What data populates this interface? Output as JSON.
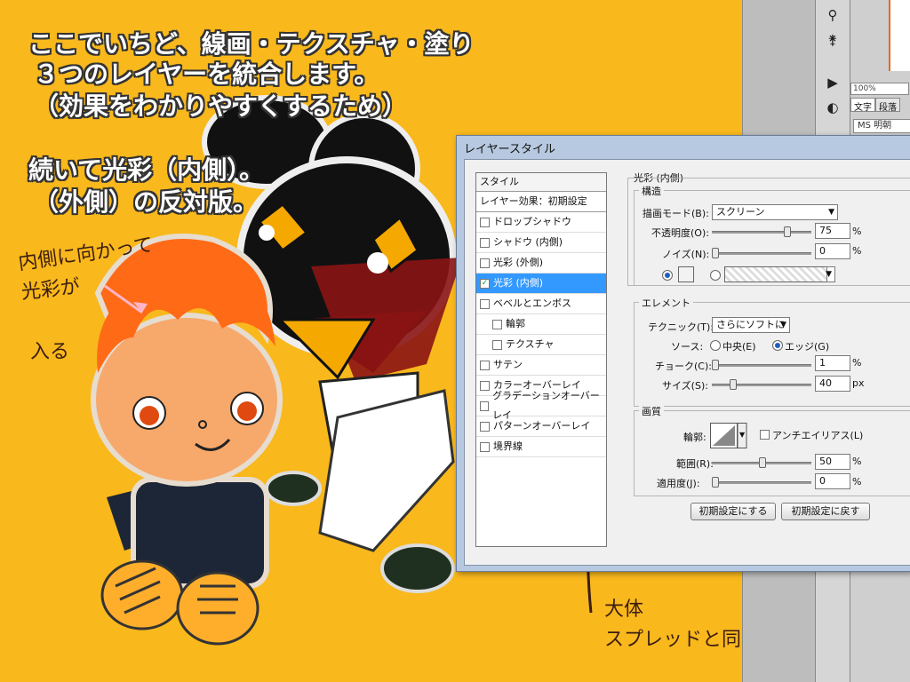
{
  "annotations": {
    "line1": "ここでいちど、線画・テクスチャ・塗り",
    "line2": "３つのレイヤーを統合します。",
    "line3": "（効果をわかりやすくするため）",
    "line4": "続いて光彩（内側）。",
    "line5": "（外側）の反対版。",
    "hand_left_1": "内側に向かって",
    "hand_left_2": "光彩が",
    "hand_left_3": "入る",
    "hand_bottom_1": "大体",
    "hand_bottom_2": "スプレッドと同じかんじ。"
  },
  "right_panel": {
    "zoom": "100%",
    "tab_text": "文字",
    "tab_paragraph": "段落",
    "font": "MS 明朝"
  },
  "dialog": {
    "title": "レイヤースタイル",
    "style_header": "スタイル",
    "blend_default": "レイヤー効果：初期設定",
    "styles": [
      {
        "label": "ドロップシャドウ",
        "checked": false,
        "selected": false,
        "sub": false
      },
      {
        "label": "シャドウ (内側)",
        "checked": false,
        "selected": false,
        "sub": false
      },
      {
        "label": "光彩 (外側)",
        "checked": false,
        "selected": false,
        "sub": false
      },
      {
        "label": "光彩 (内側)",
        "checked": true,
        "selected": true,
        "sub": false
      },
      {
        "label": "ベベルとエンボス",
        "checked": false,
        "selected": false,
        "sub": false
      },
      {
        "label": "輪郭",
        "checked": false,
        "selected": false,
        "sub": true
      },
      {
        "label": "テクスチャ",
        "checked": false,
        "selected": false,
        "sub": true
      },
      {
        "label": "サテン",
        "checked": false,
        "selected": false,
        "sub": false
      },
      {
        "label": "カラーオーバーレイ",
        "checked": false,
        "selected": false,
        "sub": false
      },
      {
        "label": "グラデーションオーバーレイ",
        "checked": false,
        "selected": false,
        "sub": false
      },
      {
        "label": "パターンオーバーレイ",
        "checked": false,
        "selected": false,
        "sub": false
      },
      {
        "label": "境界線",
        "checked": false,
        "selected": false,
        "sub": false
      }
    ],
    "panel_title": "光彩 (内側)",
    "structure": {
      "title": "構造",
      "blend_mode_label": "描画モード(B):",
      "blend_mode_value": "スクリーン",
      "opacity_label": "不透明度(O):",
      "opacity_value": "75",
      "noise_label": "ノイズ(N):",
      "noise_value": "0",
      "unit_percent": "%"
    },
    "elements": {
      "title": "エレメント",
      "technique_label": "テクニック(T):",
      "technique_value": "さらにソフトに",
      "source_label": "ソース:",
      "source_center": "中央(E)",
      "source_edge": "エッジ(G)",
      "choke_label": "チョーク(C):",
      "choke_value": "1",
      "size_label": "サイズ(S):",
      "size_value": "40",
      "unit_px": "px"
    },
    "quality": {
      "title": "画質",
      "contour_label": "輪郭:",
      "antialias_label": "アンチエイリアス(L)",
      "range_label": "範囲(R):",
      "range_value": "50",
      "jitter_label": "適用度(J):",
      "jitter_value": "0"
    },
    "btn_make_default": "初期設定にする",
    "btn_reset_default": "初期設定に戻す"
  },
  "colors": {
    "canvas_bg": "#f9b81c",
    "selection": "#3399ff",
    "dialog_frame": "#b7c9e0"
  }
}
